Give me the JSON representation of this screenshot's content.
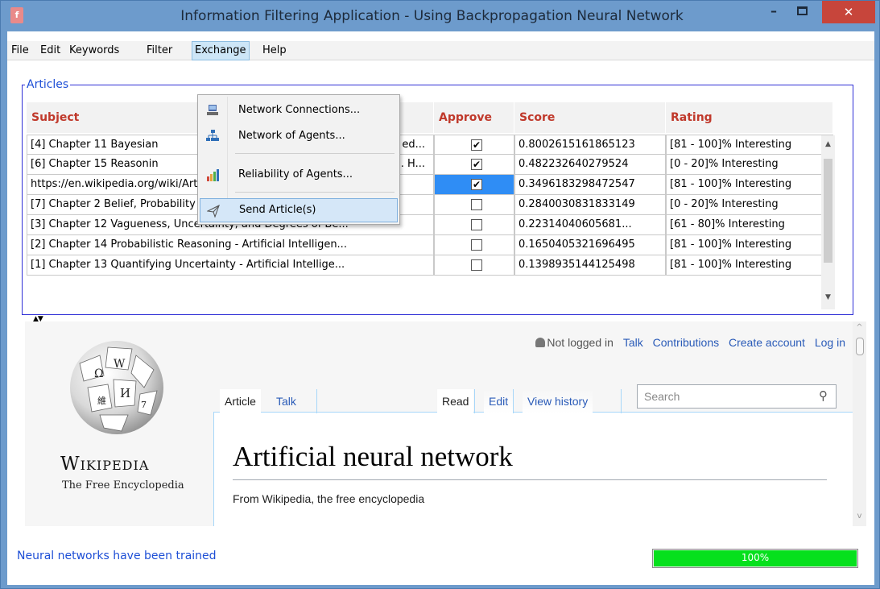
{
  "window": {
    "title": "Information Filtering Application - Using Backpropagation Neural Network",
    "minimize": "–",
    "close": "✕"
  },
  "menu": [
    "File",
    "Edit",
    "Keywords",
    "Filter",
    "Exchange",
    "Help"
  ],
  "dropdown": {
    "items": [
      {
        "label": "Network Connections...",
        "icon": "network-connections-icon"
      },
      {
        "label": "Network of Agents...",
        "icon": "network-agents-icon"
      },
      {
        "label": "Reliability of Agents...",
        "icon": "bar-chart-icon"
      },
      {
        "label": "Send Article(s)",
        "icon": "send-icon"
      }
    ]
  },
  "articles": {
    "legend": "Articles",
    "columns": [
      "Subject",
      "Approve",
      "Score",
      "Rating"
    ],
    "rows": [
      {
        "subject": "[4] Chapter 11 Bayesian",
        "subject_tail": "ed...",
        "approve": true,
        "score": "0.8002615161865123",
        "rating": "[81 - 100]% Interesting"
      },
      {
        "subject": "[6] Chapter 15 Reasonin",
        "subject_tail": ". H...",
        "approve": true,
        "score": "0.482232640279524",
        "rating": "[0 - 20]% Interesting"
      },
      {
        "subject": "https://en.wikipedia.org/wiki/Artificial_neural_network",
        "subject_tail": "",
        "approve": true,
        "score": "0.3496183298472547",
        "rating": "[81 - 100]% Interesting"
      },
      {
        "subject": "[7] Chapter 2 Belief, Probability and Exchangeability - A Fir...",
        "subject_tail": "",
        "approve": false,
        "score": "0.2840030831833149",
        "rating": "[0 - 20]% Interesting"
      },
      {
        "subject": "[3] Chapter 12 Vagueness, Uncertainty, and Degrees of Be...",
        "subject_tail": "",
        "approve": false,
        "score": "0.22314040605681...",
        "rating": "[61 - 80]% Interesting"
      },
      {
        "subject": "[2] Chapter 14 Probabilistic Reasoning - Artificial Intelligen...",
        "subject_tail": "",
        "approve": false,
        "score": "0.1650405321696495",
        "rating": "[81 - 100]% Interesting"
      },
      {
        "subject": "[1] Chapter 13 Quantifying Uncertainty - Artificial Intellige...",
        "subject_tail": "",
        "approve": false,
        "score": "0.1398935144125498",
        "rating": "[81 - 100]% Interesting"
      }
    ],
    "selected_row": 2
  },
  "browser": {
    "wiki_name": "Wikipedia",
    "wiki_tagline": "The Free Encyclopedia",
    "top_links": {
      "not_logged_in": "Not logged in",
      "talk": "Talk",
      "contributions": "Contributions",
      "create_account": "Create account",
      "log_in": "Log in"
    },
    "tabs_left": [
      "Article",
      "Talk"
    ],
    "tabs_right": [
      "Read",
      "Edit",
      "View history"
    ],
    "search_placeholder": "Search",
    "article_title": "Artificial neural network",
    "article_subtitle": "From Wikipedia, the free encyclopedia"
  },
  "status": {
    "message": "Neural networks have been trained",
    "progress_label": "100%",
    "progress": 1.0
  },
  "colors": {
    "titlebar": "#6d9bcc",
    "close_button": "#c7453b",
    "header_text": "#c0392b",
    "legend": "#1e4fd6",
    "progress_fill": "#06e01d",
    "selection": "#2f8df5"
  }
}
